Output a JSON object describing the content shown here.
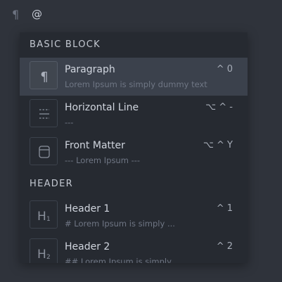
{
  "editor": {
    "pilcrow": "¶",
    "typed_text": "@"
  },
  "menu": {
    "sections": [
      {
        "title": "BASIC BLOCK",
        "items": [
          {
            "icon": "paragraph-icon",
            "title": "Paragraph",
            "description": "Lorem Ipsum is simply dummy text",
            "shortcut": "^ 0",
            "active": true
          },
          {
            "icon": "horizontal-line-icon",
            "title": "Horizontal Line",
            "description": "---",
            "shortcut": "⌥ ^ -"
          },
          {
            "icon": "front-matter-icon",
            "title": "Front Matter",
            "description": "--- Lorem Ipsum ---",
            "shortcut": "⌥ ^ Y"
          }
        ]
      },
      {
        "title": "HEADER",
        "items": [
          {
            "icon": "header-1-icon",
            "title": "Header 1",
            "description": "# Lorem Ipsum is simply ...",
            "shortcut": "^ 1"
          },
          {
            "icon": "header-2-icon",
            "title": "Header 2",
            "description": "## Lorem Ipsum is simply ...",
            "shortcut": "^ 2"
          }
        ]
      }
    ]
  },
  "colors": {
    "background": "#2f333b",
    "menu_background": "#262a31",
    "active_row": "#3b414c",
    "text_primary": "#d0d5de",
    "text_secondary": "#6f7684"
  }
}
